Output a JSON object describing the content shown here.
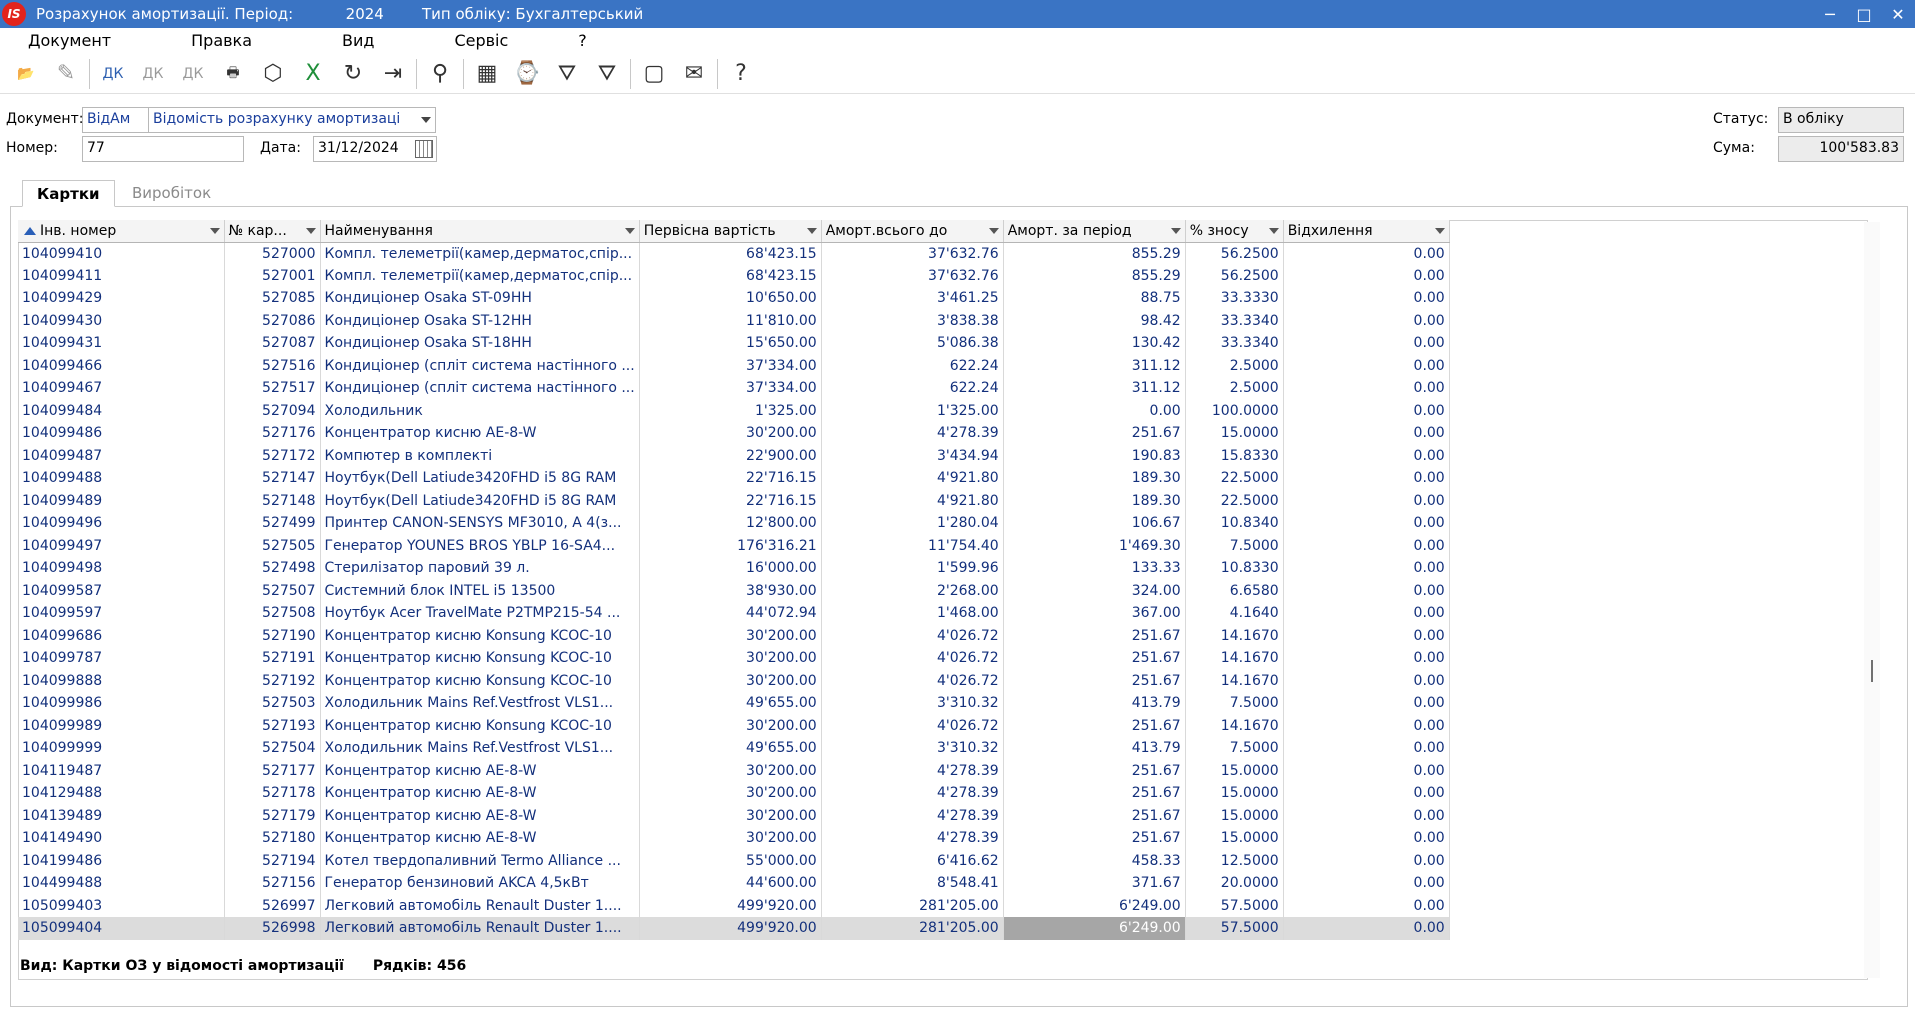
{
  "window": {
    "title": "Розрахунок амортизації. Період:           2024        Тип обліку: Бухгалтерський",
    "logo": "IS",
    "minimize_icon": "─",
    "maximize_icon": "□",
    "close_icon": "✕"
  },
  "menu": [
    "Документ",
    "Правка",
    "Вид",
    "Сервіс",
    "?"
  ],
  "header": {
    "document_label": "Документ:",
    "document_code": "ВідАм",
    "document_name": "Відомість розрахунку амортизаці",
    "number_label": "Номер:",
    "number_value": "77",
    "date_label": "Дата:",
    "date_value": "31/12/2024",
    "status_label": "Статус:",
    "status_value": "В обліку",
    "sum_label": "Сума:",
    "sum_value": "100'583.83"
  },
  "tabs": {
    "cards": "Картки",
    "output": "Виробіток"
  },
  "columns": {
    "inv": "Інв. номер",
    "card": "№ кар...",
    "name": "Найменування",
    "initial": "Первісна вартість",
    "amort_before": "Аморт.всього до",
    "amort_period": "Аморт. за період",
    "wear": "% зносу",
    "deviation": "Відхилення"
  },
  "rows": [
    [
      "104099410",
      "527000",
      "Компл. телеметрії(камер,дерматос,спір...",
      "68'423.15",
      "37'632.76",
      "855.29",
      "56.2500",
      "0.00"
    ],
    [
      "104099411",
      "527001",
      "Компл. телеметрії(камер,дерматос,спір...",
      "68'423.15",
      "37'632.76",
      "855.29",
      "56.2500",
      "0.00"
    ],
    [
      "104099429",
      "527085",
      "Кондиціонер Osaka ST-09HH",
      "10'650.00",
      "3'461.25",
      "88.75",
      "33.3330",
      "0.00"
    ],
    [
      "104099430",
      "527086",
      "Кондиціонер Osaka ST-12HH",
      "11'810.00",
      "3'838.38",
      "98.42",
      "33.3340",
      "0.00"
    ],
    [
      "104099431",
      "527087",
      "Кондиціонер Osaka ST-18HH",
      "15'650.00",
      "5'086.38",
      "130.42",
      "33.3340",
      "0.00"
    ],
    [
      "104099466",
      "527516",
      "Кондиціонер (спліт система настінного ...",
      "37'334.00",
      "622.24",
      "311.12",
      "2.5000",
      "0.00"
    ],
    [
      "104099467",
      "527517",
      "Кондиціонер (спліт система настінного ...",
      "37'334.00",
      "622.24",
      "311.12",
      "2.5000",
      "0.00"
    ],
    [
      "104099484",
      "527094",
      "Холодильник",
      "1'325.00",
      "1'325.00",
      "0.00",
      "100.0000",
      "0.00"
    ],
    [
      "104099486",
      "527176",
      "Концентратор кисню AE-8-W",
      "30'200.00",
      "4'278.39",
      "251.67",
      "15.0000",
      "0.00"
    ],
    [
      "104099487",
      "527172",
      "Компютер в комплекті",
      "22'900.00",
      "3'434.94",
      "190.83",
      "15.8330",
      "0.00"
    ],
    [
      "104099488",
      "527147",
      "Ноутбук(Dell Latiude3420FHD i5 8G RAM",
      "22'716.15",
      "4'921.80",
      "189.30",
      "22.5000",
      "0.00"
    ],
    [
      "104099489",
      "527148",
      "Ноутбук(Dell Latiude3420FHD i5 8G RAM",
      "22'716.15",
      "4'921.80",
      "189.30",
      "22.5000",
      "0.00"
    ],
    [
      "104099496",
      "527499",
      "Принтер CANON-SENSYS MF3010, A 4(з...",
      "12'800.00",
      "1'280.04",
      "106.67",
      "10.8340",
      "0.00"
    ],
    [
      "104099497",
      "527505",
      "Генератор YOUNES BROS YBLP 16-SA4...",
      "176'316.21",
      "11'754.40",
      "1'469.30",
      "7.5000",
      "0.00"
    ],
    [
      "104099498",
      "527498",
      "Стерилізатор паровий 39 л.",
      "16'000.00",
      "1'599.96",
      "133.33",
      "10.8330",
      "0.00"
    ],
    [
      "104099587",
      "527507",
      "Системний блок INTEL i5 13500",
      "38'930.00",
      "2'268.00",
      "324.00",
      "6.6580",
      "0.00"
    ],
    [
      "104099597",
      "527508",
      "Ноутбук Acer TravelMate P2TMP215-54 ...",
      "44'072.94",
      "1'468.00",
      "367.00",
      "4.1640",
      "0.00"
    ],
    [
      "104099686",
      "527190",
      "Концентратор кисню Konsung KCOC-10",
      "30'200.00",
      "4'026.72",
      "251.67",
      "14.1670",
      "0.00"
    ],
    [
      "104099787",
      "527191",
      "Концентратор кисню Konsung KCOC-10",
      "30'200.00",
      "4'026.72",
      "251.67",
      "14.1670",
      "0.00"
    ],
    [
      "104099888",
      "527192",
      "Концентратор кисню Konsung KCOC-10",
      "30'200.00",
      "4'026.72",
      "251.67",
      "14.1670",
      "0.00"
    ],
    [
      "104099986",
      "527503",
      "Холодильник  Mains Ref.Vestfrost VLS1...",
      "49'655.00",
      "3'310.32",
      "413.79",
      "7.5000",
      "0.00"
    ],
    [
      "104099989",
      "527193",
      "Концентратор кисню Konsung KCOC-10",
      "30'200.00",
      "4'026.72",
      "251.67",
      "14.1670",
      "0.00"
    ],
    [
      "104099999",
      "527504",
      "Холодильник Mains Ref.Vestfrost VLS1...",
      "49'655.00",
      "3'310.32",
      "413.79",
      "7.5000",
      "0.00"
    ],
    [
      "104119487",
      "527177",
      "Концентратор кисню AE-8-W",
      "30'200.00",
      "4'278.39",
      "251.67",
      "15.0000",
      "0.00"
    ],
    [
      "104129488",
      "527178",
      "Концентратор кисню AE-8-W",
      "30'200.00",
      "4'278.39",
      "251.67",
      "15.0000",
      "0.00"
    ],
    [
      "104139489",
      "527179",
      "Концентратор кисню AE-8-W",
      "30'200.00",
      "4'278.39",
      "251.67",
      "15.0000",
      "0.00"
    ],
    [
      "104149490",
      "527180",
      "Концентратор кисню AE-8-W",
      "30'200.00",
      "4'278.39",
      "251.67",
      "15.0000",
      "0.00"
    ],
    [
      "104199486",
      "527194",
      "Котел твердопаливний Termo Alliance ...",
      "55'000.00",
      "6'416.62",
      "458.33",
      "12.5000",
      "0.00"
    ],
    [
      "104499488",
      "527156",
      "Генератор бензиновий AKCA 4,5кВт",
      "44'600.00",
      "8'548.41",
      "371.67",
      "20.0000",
      "0.00"
    ],
    [
      "105099403",
      "526997",
      "Легковий автомобіль Renault Duster 1....",
      "499'920.00",
      "281'205.00",
      "6'249.00",
      "57.5000",
      "0.00"
    ],
    [
      "105099404",
      "526998",
      "Легковий автомобіль Renault Duster 1....",
      "499'920.00",
      "281'205.00",
      "6'249.00",
      "57.5000",
      "0.00"
    ]
  ],
  "selected_row": 30,
  "footer": {
    "view": "Вид: Картки ОЗ у відомості амортизації",
    "rows": "Рядків: 456"
  },
  "toolbar_icons": [
    {
      "name": "open-folder-icon",
      "glyph": "📂",
      "cls": ""
    },
    {
      "name": "edit-document-icon",
      "glyph": "✎",
      "cls": "dim"
    },
    {
      "name": "debit-credit-icon",
      "glyph": "ДК",
      "cls": "blue"
    },
    {
      "name": "debit-credit-dim-icon",
      "glyph": "ДК",
      "cls": "dim"
    },
    {
      "name": "debit-credit-cancel-icon",
      "glyph": "ДК",
      "cls": "dim"
    },
    {
      "name": "print-icon",
      "glyph": "🖶",
      "cls": ""
    },
    {
      "name": "package-icon",
      "glyph": "⬡",
      "cls": ""
    },
    {
      "name": "excel-export-icon",
      "glyph": "X",
      "cls": "green"
    },
    {
      "name": "refresh-icon",
      "glyph": "↻",
      "cls": ""
    },
    {
      "name": "exit-icon",
      "glyph": "⇥",
      "cls": ""
    },
    {
      "name": "search-icon",
      "glyph": "⚲",
      "cls": ""
    },
    {
      "name": "table-icon",
      "glyph": "▦",
      "cls": ""
    },
    {
      "name": "history-icon",
      "glyph": "⌚",
      "cls": ""
    },
    {
      "name": "filter-icon",
      "glyph": "⛛",
      "cls": ""
    },
    {
      "name": "clear-filter-icon",
      "glyph": "⛛",
      "cls": ""
    },
    {
      "name": "window-icon",
      "glyph": "▢",
      "cls": ""
    },
    {
      "name": "mail-icon",
      "glyph": "✉",
      "cls": ""
    },
    {
      "name": "help-icon",
      "glyph": "?",
      "cls": ""
    }
  ]
}
